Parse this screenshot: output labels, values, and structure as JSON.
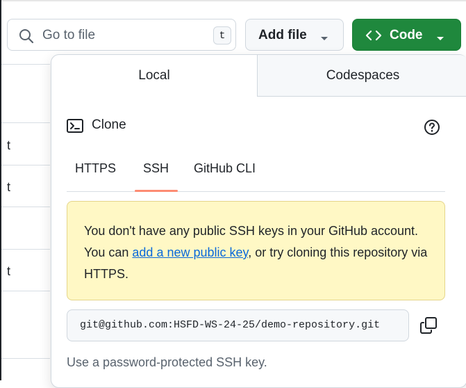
{
  "search": {
    "placeholder": "Go to file",
    "shortcut": "t"
  },
  "toolbar": {
    "add_file_label": "Add file",
    "code_label": "Code"
  },
  "background_rows": [
    {
      "text": "t"
    },
    {
      "text": "t"
    },
    {
      "text": "t"
    }
  ],
  "panel": {
    "tabs": [
      {
        "label": "Local"
      },
      {
        "label": "Codespaces"
      }
    ],
    "clone_title": "Clone",
    "protocols": [
      {
        "label": "HTTPS"
      },
      {
        "label": "SSH"
      },
      {
        "label": "GitHub CLI"
      }
    ],
    "active_protocol": "SSH",
    "warning": {
      "part1": "You don't have any public SSH keys in your GitHub account. You can ",
      "link": "add a new public key",
      "part2": ", or try cloning this repository via HTTPS."
    },
    "clone_url": "git@github.com:HSFD-WS-24-25/demo-repository.git",
    "note": "Use a password-protected SSH key."
  },
  "colors": {
    "accent_green": "#1f883d",
    "link_blue": "#0969da",
    "warning_bg": "#fff8c5",
    "tab_underline": "#fd8c73"
  },
  "icons": [
    "search-icon",
    "chevron-down-icon",
    "code-icon",
    "terminal-icon",
    "question-icon",
    "copy-icon"
  ]
}
